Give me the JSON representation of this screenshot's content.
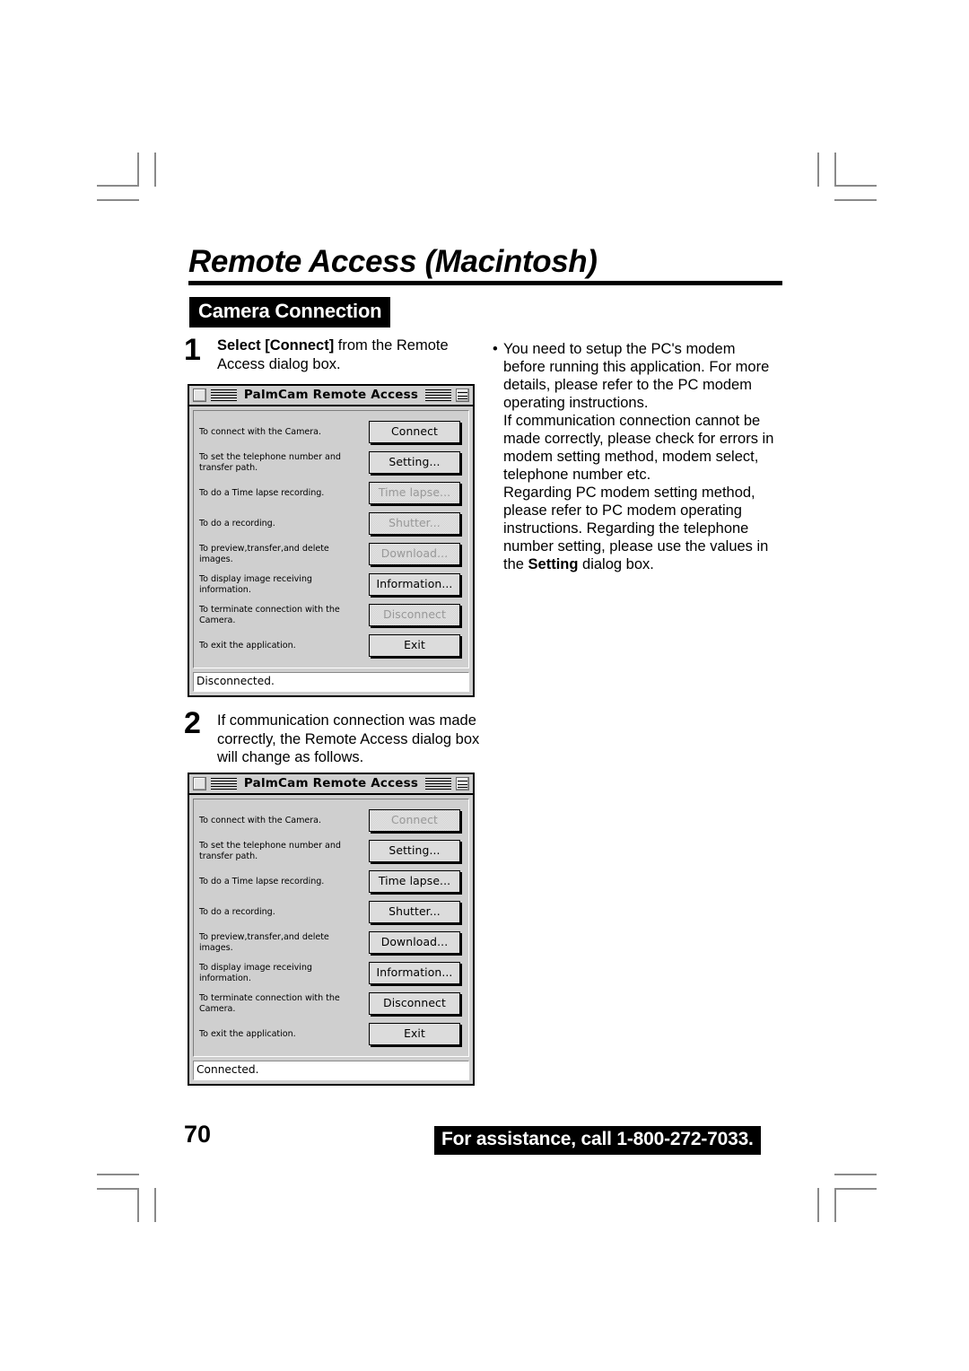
{
  "document": {
    "page_title": "Remote Access (Macintosh)",
    "section_banner": "Camera Connection",
    "page_number": "70",
    "assistance": "For assistance, call 1-800-272-7033."
  },
  "steps": [
    {
      "number": "1",
      "text_bold": "Select [Connect]",
      "text_normal": " from the Remote Access dialog box."
    },
    {
      "number": "2",
      "text": "If communication connection was made correctly, the Remote Access dialog box will change as follows."
    }
  ],
  "notes": {
    "bullet": "•",
    "paragraphs": [
      "You need to setup the PC's modem before running this application. For more details, please refer to the PC modem operating instructions.",
      "If communication connection cannot be made correctly, please check for errors in modem setting method, modem select, telephone number etc.",
      "Regarding PC modem setting method, please refer to PC modem operating instructions. Regarding the telephone number setting, please use the values in the "
    ],
    "emphasis": "Setting",
    "paragraph_tail": " dialog box."
  },
  "dialog_disconnected": {
    "title": "PalmCam Remote Access",
    "status": "Disconnected.",
    "rows": [
      {
        "description": "To connect with the Camera.",
        "button": "Connect",
        "enabled": true
      },
      {
        "description": "To set the telephone number and transfer path.",
        "button": "Setting...",
        "enabled": true
      },
      {
        "description": "To do a Time lapse recording.",
        "button": "Time lapse...",
        "enabled": false
      },
      {
        "description": "To do a recording.",
        "button": "Shutter...",
        "enabled": false
      },
      {
        "description": "To preview,transfer,and delete images.",
        "button": "Download...",
        "enabled": false
      },
      {
        "description": "To display image receiving information.",
        "button": "Information...",
        "enabled": true
      },
      {
        "description": "To terminate connection with the Camera.",
        "button": "Disconnect",
        "enabled": false
      },
      {
        "description": "To exit the application.",
        "button": "Exit",
        "enabled": true
      }
    ]
  },
  "dialog_connected": {
    "title": "PalmCam Remote Access",
    "status": "Connected.",
    "rows": [
      {
        "description": "To connect with the Camera.",
        "button": "Connect",
        "enabled": false
      },
      {
        "description": "To set the telephone number and transfer path.",
        "button": "Setting...",
        "enabled": true
      },
      {
        "description": "To do a Time lapse recording.",
        "button": "Time lapse...",
        "enabled": true
      },
      {
        "description": "To do a recording.",
        "button": "Shutter...",
        "enabled": true
      },
      {
        "description": "To preview,transfer,and delete images.",
        "button": "Download...",
        "enabled": true
      },
      {
        "description": "To display image receiving information.",
        "button": "Information...",
        "enabled": true
      },
      {
        "description": "To terminate connection with the Camera.",
        "button": "Disconnect",
        "enabled": true
      },
      {
        "description": "To exit the application.",
        "button": "Exit",
        "enabled": true
      }
    ]
  }
}
